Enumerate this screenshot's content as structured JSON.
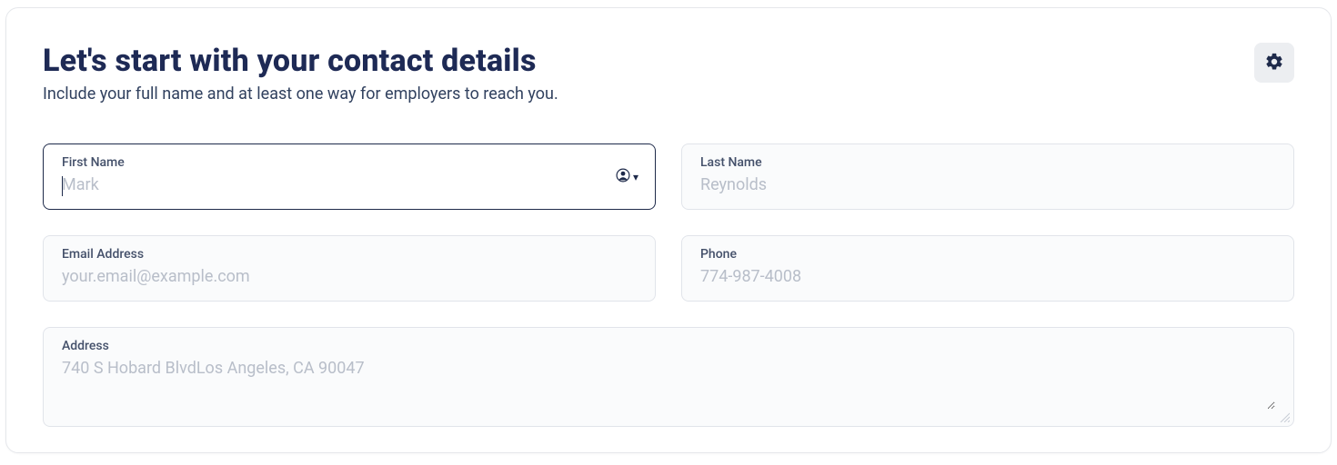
{
  "header": {
    "title": "Let's start with your contact details",
    "subtitle": "Include your full name and at least one way for employers to reach you."
  },
  "fields": {
    "first_name": {
      "label": "First Name",
      "placeholder": "Mark",
      "value": ""
    },
    "last_name": {
      "label": "Last Name",
      "placeholder": "Reynolds",
      "value": ""
    },
    "email": {
      "label": "Email Address",
      "placeholder": "your.email@example.com",
      "value": ""
    },
    "phone": {
      "label": "Phone",
      "placeholder": "774-987-4008",
      "value": ""
    },
    "address": {
      "label": "Address",
      "placeholder": "740 S Hobard BlvdLos Angeles, CA 90047",
      "value": ""
    }
  },
  "icons": {
    "settings": "gear-icon",
    "autofill": "person-circle-icon"
  }
}
